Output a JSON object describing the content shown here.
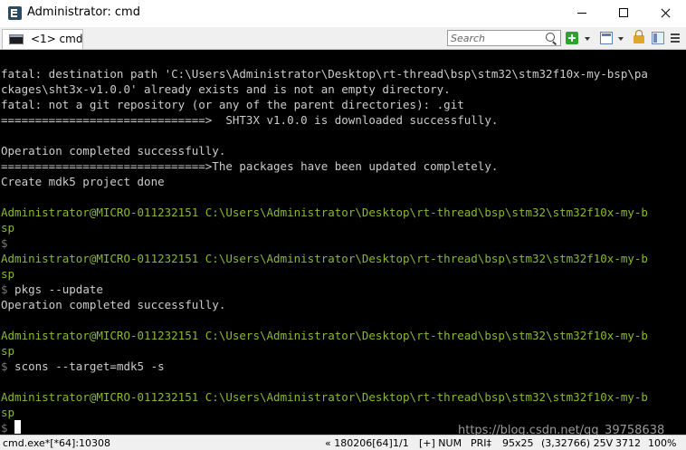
{
  "window": {
    "title": "Administrator: cmd"
  },
  "tabbar": {
    "tab_label": "<1> cmd",
    "search_placeholder": "Search"
  },
  "colors": {
    "console_bg": "#000000",
    "text": "#cccccc",
    "prompt_green": "#8ab832",
    "path_white": "#cccccc",
    "cursor": "#ffffff"
  },
  "console": {
    "lines": [
      [
        {
          "t": "fatal: destination path 'C:\\Users\\Administrator\\Desktop\\rt-thread\\bsp\\stm32\\stm32f10x-my-bsp\\pa",
          "c": "#cccccc"
        }
      ],
      [
        {
          "t": "ckages\\sht3x-v1.0.0' already exists and is not an empty directory.",
          "c": "#cccccc"
        }
      ],
      [
        {
          "t": "fatal: not a git repository (or any of the parent directories): .git",
          "c": "#cccccc"
        }
      ],
      [
        {
          "t": "==============================>  SHT3X v1.0.0 is downloaded successfully.",
          "c": "#cccccc"
        }
      ],
      [],
      [
        {
          "t": "Operation completed successfully.",
          "c": "#cccccc"
        }
      ],
      [
        {
          "t": "==============================>The packages have been updated completely.",
          "c": "#cccccc"
        }
      ],
      [
        {
          "t": "Create mdk5 project done",
          "c": "#cccccc"
        }
      ],
      [],
      [
        {
          "t": "Administrator@MICRO-011232151 ",
          "c": "#8ab832"
        },
        {
          "t": "C:\\Users\\Administrator\\Desktop\\rt-thread\\bsp\\stm32\\stm32f10x-my-b",
          "c": "#8ab832"
        }
      ],
      [
        {
          "t": "sp",
          "c": "#8ab832"
        }
      ],
      [
        {
          "t": "$",
          "c": "#777777"
        }
      ],
      [
        {
          "t": "Administrator@MICRO-011232151 ",
          "c": "#8ab832"
        },
        {
          "t": "C:\\Users\\Administrator\\Desktop\\rt-thread\\bsp\\stm32\\stm32f10x-my-b",
          "c": "#8ab832"
        }
      ],
      [
        {
          "t": "sp",
          "c": "#8ab832"
        }
      ],
      [
        {
          "t": "$",
          "c": "#777777"
        },
        {
          "t": " pkgs --update",
          "c": "#cccccc"
        }
      ],
      [
        {
          "t": "Operation completed successfully.",
          "c": "#cccccc"
        }
      ],
      [],
      [
        {
          "t": "Administrator@MICRO-011232151 ",
          "c": "#8ab832"
        },
        {
          "t": "C:\\Users\\Administrator\\Desktop\\rt-thread\\bsp\\stm32\\stm32f10x-my-b",
          "c": "#8ab832"
        }
      ],
      [
        {
          "t": "sp",
          "c": "#8ab832"
        }
      ],
      [
        {
          "t": "$",
          "c": "#777777"
        },
        {
          "t": " scons --target=mdk5 -s",
          "c": "#cccccc"
        }
      ],
      [],
      [
        {
          "t": "Administrator@MICRO-011232151 ",
          "c": "#8ab832"
        },
        {
          "t": "C:\\Users\\Administrator\\Desktop\\rt-thread\\bsp\\stm32\\stm32f10x-my-b",
          "c": "#8ab832"
        }
      ],
      [
        {
          "t": "sp",
          "c": "#8ab832"
        }
      ],
      [
        {
          "t": "$",
          "c": "#777777"
        }
      ]
    ]
  },
  "watermark": "https://blog.csdn.net/qq_39758638",
  "statusbar": {
    "process": "cmd.exe*[*64]:10308",
    "position": "« 180206[64]",
    "page": "1/1",
    "mode": "[+] NUM",
    "priority": "PRI‡",
    "size": "95x25",
    "coords": "(3,32766) 25V",
    "pid": "3712",
    "zoom": "100%"
  }
}
